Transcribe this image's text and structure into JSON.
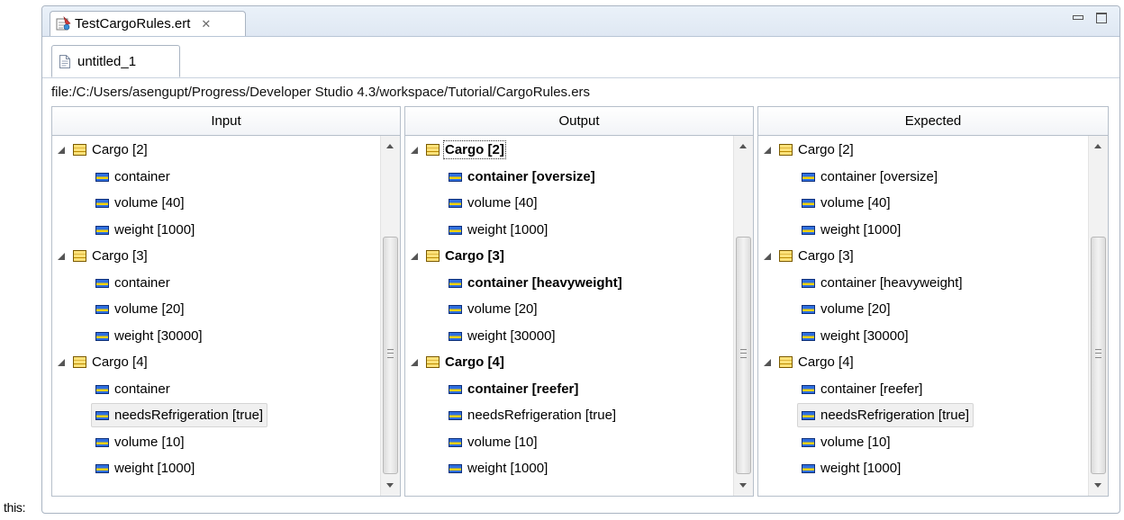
{
  "caption": "this:",
  "editor": {
    "tab_title": "TestCargoRules.ert",
    "close_glyph": "✕"
  },
  "subtab": {
    "label": "untitled_1"
  },
  "path": "file:/C:/Users/asengupt/Progress/Developer Studio 4.3/workspace/Tutorial/CargoRules.ers",
  "panes": {
    "input": {
      "header": "Input",
      "c2": "Cargo [2]",
      "c2_a1": "container",
      "c2_a2": "volume [40]",
      "c2_a3": "weight [1000]",
      "c3": "Cargo [3]",
      "c3_a1": "container",
      "c3_a2": "volume [20]",
      "c3_a3": "weight [30000]",
      "c4": "Cargo [4]",
      "c4_a1": "container",
      "c4_a2": "needsRefrigeration [true]",
      "c4_a3": "volume [10]",
      "c4_a4": "weight [1000]"
    },
    "output": {
      "header": "Output",
      "c2": "Cargo [2]",
      "c2_a1": "container [oversize]",
      "c2_a2": "volume [40]",
      "c2_a3": "weight [1000]",
      "c3": "Cargo [3]",
      "c3_a1": "container [heavyweight]",
      "c3_a2": "volume [20]",
      "c3_a3": "weight [30000]",
      "c4": "Cargo [4]",
      "c4_a1": "container [reefer]",
      "c4_a2": "needsRefrigeration [true]",
      "c4_a3": "volume [10]",
      "c4_a4": "weight [1000]"
    },
    "expected": {
      "header": "Expected",
      "c2": "Cargo [2]",
      "c2_a1": "container [oversize]",
      "c2_a2": "volume [40]",
      "c2_a3": "weight [1000]",
      "c3": "Cargo [3]",
      "c3_a1": "container [heavyweight]",
      "c3_a2": "volume [20]",
      "c3_a3": "weight [30000]",
      "c4": "Cargo [4]",
      "c4_a1": "container [reefer]",
      "c4_a2": "needsRefrigeration [true]",
      "c4_a3": "volume [10]",
      "c4_a4": "weight [1000]"
    }
  },
  "colors": {
    "entity_icon": "#ffe27a",
    "attribute_icon": "#2f6fe0",
    "highlight_row": "#f0f0f0"
  },
  "icons": [
    "rule-test-icon",
    "close-icon",
    "minimize-icon",
    "maximize-icon",
    "document-icon",
    "expand-icon",
    "entity-icon",
    "attribute-icon",
    "scroll-up-icon",
    "scroll-down-icon"
  ]
}
